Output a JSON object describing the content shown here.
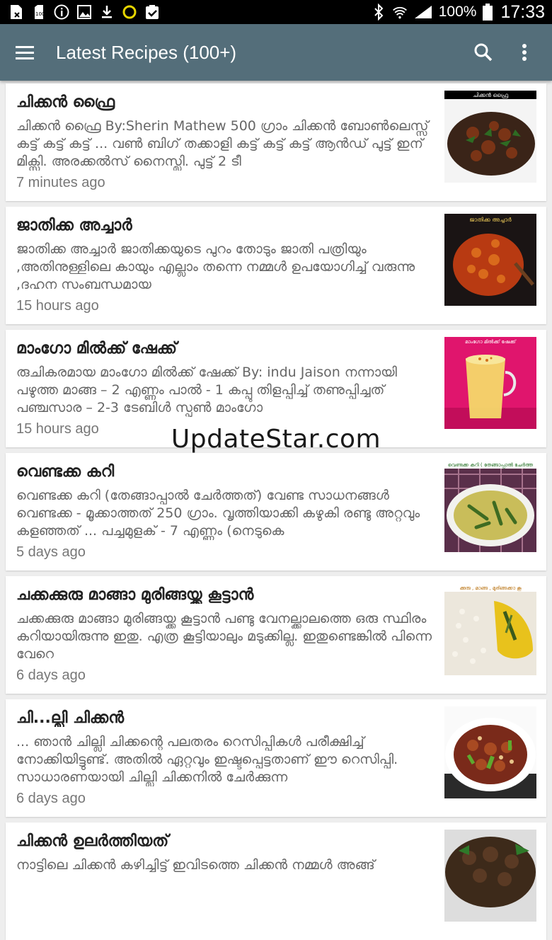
{
  "status_bar": {
    "battery": "100%",
    "time": "17:33"
  },
  "app_bar": {
    "title": "Latest Recipes (100+)"
  },
  "recipes": [
    {
      "title": "ചിക്കൻ ഫ്രൈ",
      "desc": "ചിക്കൻ ഫ്രൈ By:Sherin Mathew 500 ഗ്രാം ചിക്കൻ ബോൺലെസ്സ് കട്ട് കട്ട് കട്ട് ... വൺ ബിഗ് തക്കാളി കട്ട് കട്ട് കട്ട് ആൻഡ് പുട്ട് ഇന് മിക്സി. അരക്കൽസ് നൈസ്ലി. പുട്ട് 2 ടീ",
      "time": "7 minutes ago",
      "thumb_caption": "ചിക്കൻ ഫ്രൈ"
    },
    {
      "title": "ജാതിക്ക അച്ചാർ",
      "desc": "ജാതിക്ക അച്ചാർ ജാതിക്കയുടെ പുറം തോടും ജാതി പത്രിയും ,അതിനുള്ളിലെ കായും എല്ലാം തന്നെ നമ്മൾ ഉപയോഗിച്ച് വരുന്നു ,ദഹന സംബന്ധമായ",
      "time": "15 hours ago",
      "thumb_caption": "ജാതിക്ക അച്ചാർ"
    },
    {
      "title": "മാംഗോ മിൽക്ക് ഷേക്ക്",
      "desc": "രുചികരമായ മാംഗോ മിൽക്ക് ഷേക്ക്  By: indu Jaison നന്നായി പഴുത്ത മാങ്ങ – 2 എണ്ണം  പാൽ - 1 കപ്പു തിളപ്പിച്ച് തണുപ്പിച്ചത്  പഞ്ചസാര – 2-3 ടേബിൾ സ്പൂൺ  മാംഗോ",
      "time": "15 hours ago",
      "thumb_caption": "മാംഗോ മിൽക്ക് ഷേക്ക്"
    },
    {
      "title": "വെണ്ടക്ക കറി",
      "desc": "വെണ്ടക്ക കറി (തേങ്ങാപ്പാൽ ചേർത്തത്) വേണ്ട സാധനങ്ങൾ വെണ്ടക്ക - മൂക്കാത്തത് 250 ഗ്രാം. വൃത്തിയാക്കി കഴുകി രണ്ടു അറ്റവും കളഞ്ഞത് ... പച്ചമുളക് - 7 എണ്ണം (നെടുകെ",
      "time": "5 days ago",
      "thumb_caption": "വെണ്ടക്ക കറി ( തേങ്ങാപ്പാൽ ചേർത്ത"
    },
    {
      "title": "ചക്കക്കുരു മാങ്ങാ മുരിങ്ങയ്ക്ക കൂട്ടാൻ",
      "desc": "ചക്കക്കുരു മാങ്ങാ മുരിങ്ങയ്ക്ക കൂട്ടാൻ പണ്ടു വേനല്ക്കാലത്തെ ഒരു സ്ഥിരം കറിയായിരുന്നു ഇതു. എത്ര കൂട്ടിയാലും മടുക്കില്ല. ഇതുണ്ടെങ്കിൽ പിന്നെ വേറെ",
      "time": "6 days ago",
      "thumb_caption": "ക്കുരു , മാങ്ങ , മുരിങ്ങക്കാ കൂ"
    },
    {
      "title": "ചി...ല്ലി ചിക്കൻ",
      "desc": "... ഞാൻ ചില്ലി ചിക്കന്റെ പലതരം റെസിപ്പികൾ പരീക്ഷിച്ച് നോക്കിയിട്ടുണ്ട്. അതിൽ ഏറ്റവും ഇഷ്ടപ്പെട്ടതാണ് ഈ റെസിപ്പി. സാധാരണയായി ചില്ലി ചിക്കനിൽ ചേർക്കുന്ന",
      "time": "6 days ago",
      "thumb_caption": ""
    },
    {
      "title": "ചിക്കൻ ഉലർത്തിയത്",
      "desc": "നാട്ടിലെ ചിക്കൻ കഴിച്ചിട്ട് ഇവിടത്തെ ചിക്കൻ നമ്മൾ അങ്ങ്",
      "time": "",
      "thumb_caption": ""
    }
  ],
  "watermark": "UpdateStar.com"
}
